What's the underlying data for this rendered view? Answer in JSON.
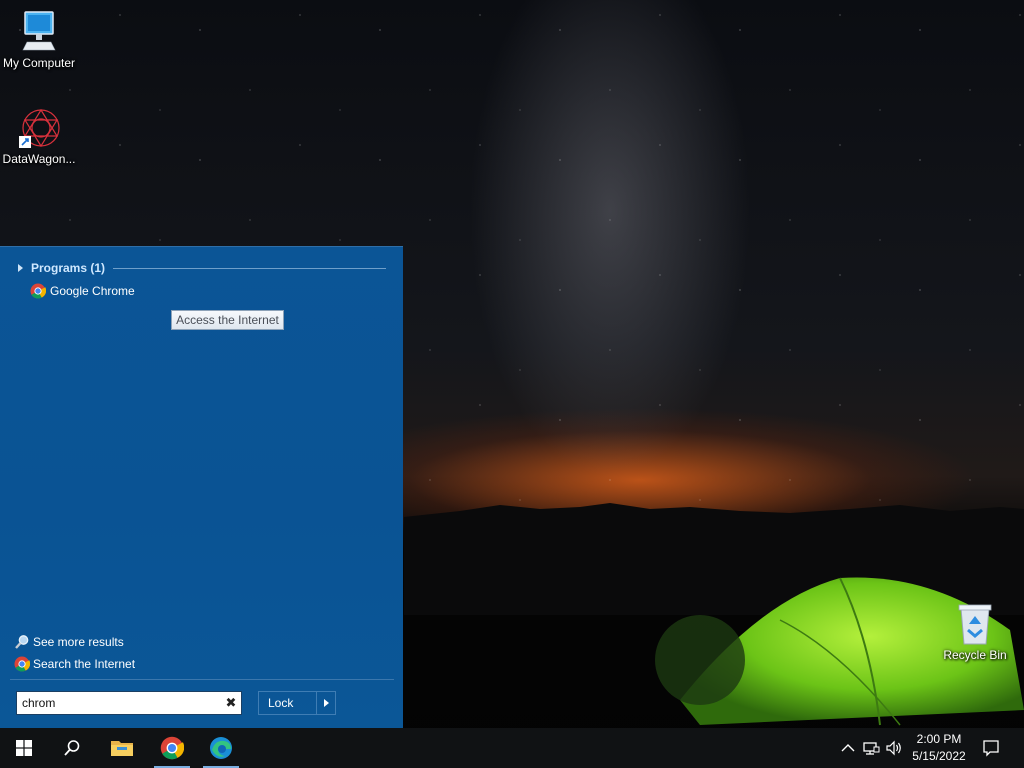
{
  "desktop": {
    "icons": [
      {
        "label": "My Computer"
      },
      {
        "label": "DataWagon..."
      },
      {
        "label": "Recycle Bin"
      }
    ]
  },
  "start_menu": {
    "group_title": "Programs (1)",
    "results": [
      {
        "label": "Google Chrome",
        "tooltip": "Access the Internet"
      }
    ],
    "links": {
      "see_more": "See more results",
      "search_internet": "Search the Internet"
    },
    "search": {
      "value": "chrom",
      "clear_glyph": "✖"
    },
    "lock_label": "Lock"
  },
  "taskbar": {
    "clock_time": "2:00 PM",
    "clock_date": "5/15/2022"
  },
  "colors": {
    "menu_bg": "#0a5394",
    "group_title": "#cfe8ff",
    "taskbar_bg": "#101214",
    "running_indicator": "#7aaee0"
  }
}
